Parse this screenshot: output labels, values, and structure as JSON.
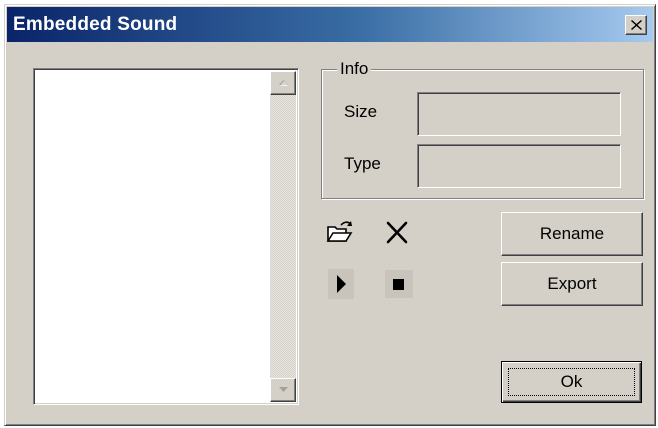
{
  "window": {
    "title": "Embedded Sound",
    "close_glyph": "✕"
  },
  "sound_list": {
    "items": []
  },
  "info": {
    "legend": "Info",
    "size_label": "Size",
    "size_value": "",
    "type_label": "Type",
    "type_value": ""
  },
  "toolbar": {
    "open_icon": "open-folder-icon",
    "delete_icon": "delete-x-icon",
    "play_icon": "play-icon",
    "stop_icon": "stop-icon"
  },
  "buttons": {
    "rename_label": "Rename",
    "export_label": "Export",
    "ok_label": "Ok"
  },
  "colors": {
    "title_gradient_start": "#0a246a",
    "title_gradient_end": "#a6caf0",
    "face": "#d4d0c8"
  }
}
